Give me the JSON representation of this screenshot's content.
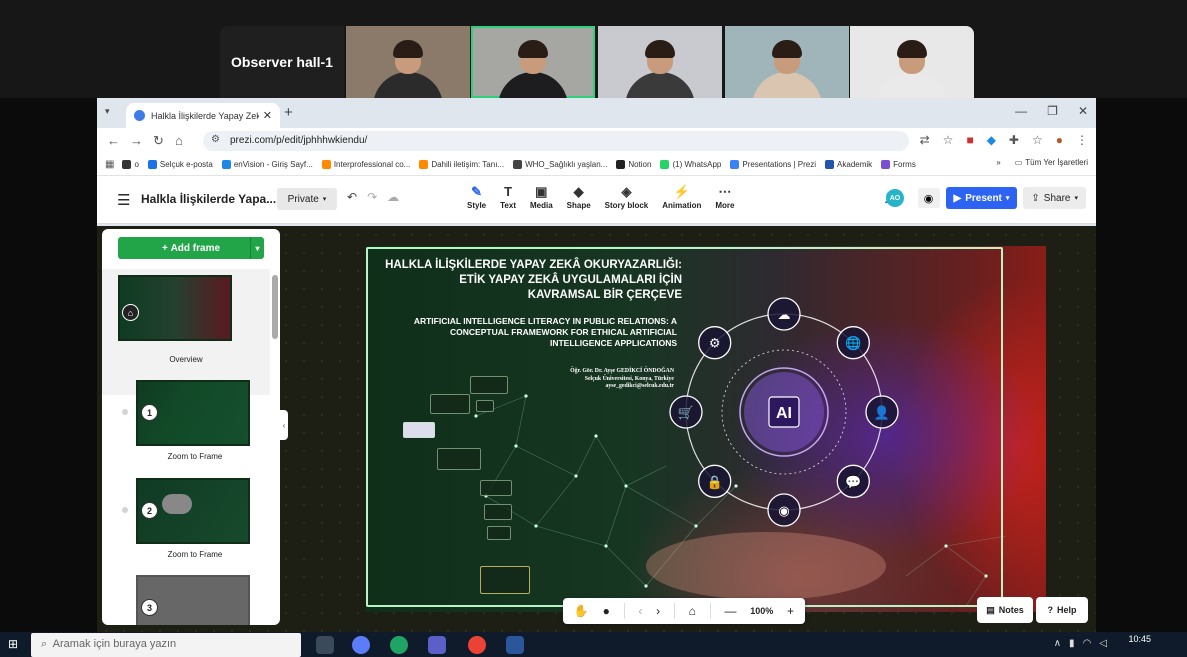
{
  "meeting": {
    "room_label": "Observer hall-1",
    "participants": [
      {
        "bg": "#8b7a6a",
        "shirt": "#2b2b2b",
        "active": false
      },
      {
        "bg": "#a6a7a2",
        "shirt": "#1d1d1f",
        "active": true
      },
      {
        "bg": "#c8cad0",
        "shirt": "#3a3a3a",
        "active": false
      },
      {
        "bg": "#9fb5b9",
        "shirt": "#d9c5b0",
        "active": false
      },
      {
        "bg": "#e8e8e8",
        "shirt": "#eaeaea",
        "active": false
      }
    ]
  },
  "browser": {
    "tab_title": "Halkla İlişkilerde Yapay Zekâ O…",
    "url": "prezi.com/p/edit/jphhhwkiendu/",
    "bookmarks": [
      {
        "label": "o",
        "color": "#333333"
      },
      {
        "label": "Selçuk e-posta",
        "color": "#1a73e8"
      },
      {
        "label": "enVision - Giriş Sayf...",
        "color": "#1e88e5"
      },
      {
        "label": "Interprofessional co...",
        "color": "#ff8a00"
      },
      {
        "label": "Dahili iletişim: Tanı...",
        "color": "#ff8a00"
      },
      {
        "label": "WHO_Sağlıklı yaşlan...",
        "color": "#444444"
      },
      {
        "label": "Notion",
        "color": "#222222"
      },
      {
        "label": "(1) WhatsApp",
        "color": "#25d366"
      },
      {
        "label": "Presentations | Prezi",
        "color": "#3b82f6"
      },
      {
        "label": "Akademik",
        "color": "#2255aa"
      },
      {
        "label": "Forms",
        "color": "#7b4fd1"
      }
    ],
    "bookmarks_more": "»",
    "all_bookmarks": "Tüm Yer İşaretleri"
  },
  "prezi": {
    "doc_title": "Halkla İlişkilerde Yapa...",
    "visibility": "Private",
    "tools": [
      "Style",
      "Text",
      "Media",
      "Shape",
      "Story block",
      "Animation",
      "More"
    ],
    "collaborator_initials": "AO",
    "present_label": "Present",
    "share_label": "Share",
    "add_frame_label": "Add frame",
    "thumbnails": [
      {
        "caption": "Overview"
      },
      {
        "num": "1",
        "caption": "Zoom to Frame"
      },
      {
        "num": "2",
        "caption": "Zoom to Frame"
      },
      {
        "num": "3",
        "caption": ""
      }
    ],
    "zoom_level": "100%",
    "notes_label": "Notes",
    "help_label": "Help"
  },
  "slide": {
    "title_lines": [
      "HALKLA İLİŞKİLERDE YAPAY ZEKÂ OKURYAZARLIĞI:",
      "ETİK YAPAY ZEKÂ UYGULAMALARI İÇİN",
      "KAVRAMSAL BİR ÇERÇEVE"
    ],
    "subtitle_lines": [
      "ARTIFICIAL INTELLIGENCE LITERACY IN PUBLIC RELATIONS: A",
      "CONCEPTUAL FRAMEWORK FOR ETHICAL ARTIFICIAL",
      "INTELLIGENCE APPLICATIONS"
    ],
    "author_lines": [
      "Öğr. Gör. Dr. Ayşe GEDİKCİ ÖNDOĞAN",
      "Selçuk Üniversitesi, Konya, Türkiye",
      "ayse_gedikci@selcuk.edu.tr"
    ],
    "ai_label": "AI"
  },
  "taskbar": {
    "search_placeholder": "Aramak için buraya yazın",
    "time": "10:45",
    "date": ""
  }
}
